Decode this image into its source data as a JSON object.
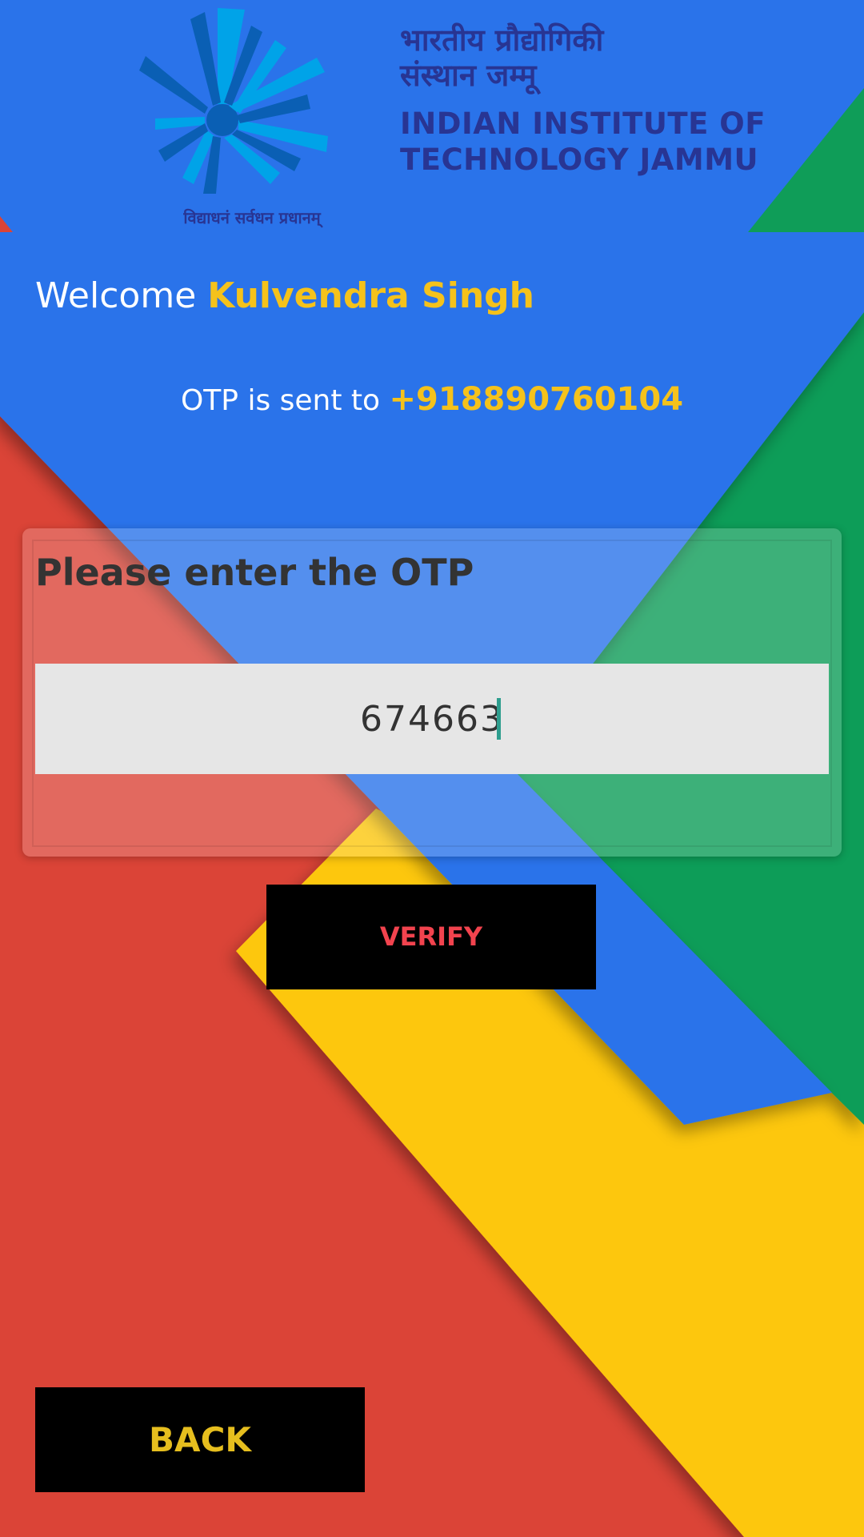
{
  "logo": {
    "hindi_line1": "भारतीय प्रौद्योगिकी",
    "hindi_line2": "संस्थान जम्मू",
    "english_line1": "INDIAN INSTITUTE OF",
    "english_line2": "TECHNOLOGY JAMMU",
    "motto": "विद्याधनं सर्वधन प्रधानम्"
  },
  "welcome": {
    "prefix": "Welcome",
    "name": "Kulvendra Singh"
  },
  "otp_notice": {
    "prefix": "OTP is sent to",
    "phone": "+918890760104"
  },
  "otp_card": {
    "title": "Please enter the OTP",
    "input_value": "674663"
  },
  "buttons": {
    "verify_label": "VERIFY",
    "back_label": "BACK"
  },
  "colors": {
    "blue": "#2A73EA",
    "red": "#DB4437",
    "yellow": "#FDC70C",
    "green": "#0F9D58",
    "accent_yellow": "#F5C21B",
    "verify_text": "#F2434E"
  }
}
